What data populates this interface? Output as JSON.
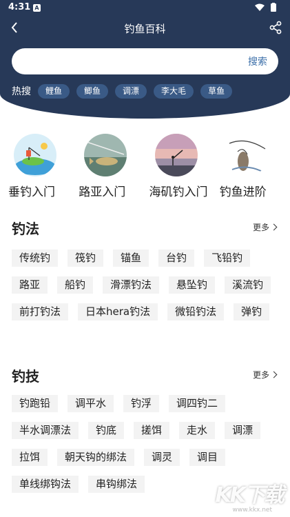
{
  "status": {
    "time": "4:31",
    "notif_letter": "A"
  },
  "header": {
    "title": "钓鱼百科"
  },
  "search": {
    "placeholder": "",
    "button": "搜索"
  },
  "hot": {
    "label": "热搜",
    "items": [
      "鲤鱼",
      "鲫鱼",
      "调漂",
      "李大毛",
      "草鱼"
    ]
  },
  "categories": [
    {
      "label": "垂钓入门",
      "icon": "fishing-basics-image"
    },
    {
      "label": "路亚入门",
      "icon": "lure-fishing-image"
    },
    {
      "label": "海矶钓入门",
      "icon": "sea-rock-fishing-image"
    },
    {
      "label": "钓鱼进阶",
      "icon": "advanced-fishing-image"
    }
  ],
  "sections": [
    {
      "title": "钓法",
      "more": "更多",
      "tags": [
        "传统钓",
        "筏钓",
        "锚鱼",
        "台钓",
        "飞铅钓",
        "路亚",
        "船钓",
        "滑漂钓法",
        "悬坠钓",
        "溪流钓",
        "前打钓法",
        "日本hera钓法",
        "微铅钓法",
        "弹钓"
      ]
    },
    {
      "title": "钓技",
      "more": "更多",
      "tags": [
        "钓跑铅",
        "调平水",
        "钓浮",
        "调四钓二",
        "半水调漂法",
        "钓底",
        "搓饵",
        "走水",
        "调漂",
        "拉饵",
        "朝天钩的绑法",
        "调灵",
        "调目",
        "单线绑钩法",
        "串钩绑法"
      ]
    }
  ],
  "watermark": {
    "text": "KK下载",
    "url": "www.kkx.net"
  },
  "colors": {
    "header_bg": "#273958",
    "chip_bg": "#3a5a86",
    "accent": "#3a6ea8",
    "tag_bg": "#f3f3f3"
  }
}
